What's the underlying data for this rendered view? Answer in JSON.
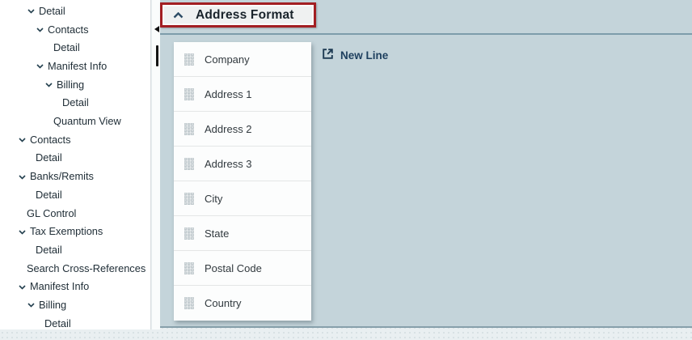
{
  "header": {
    "title": "Address Format",
    "collapse_icon": "chevron-up",
    "highlight_border_color": "#a21e22"
  },
  "toolbar": {
    "new_line_label": "New Line",
    "new_line_icon": "new-line"
  },
  "fields": [
    "Company",
    "Address 1",
    "Address 2",
    "Address 3",
    "City",
    "State",
    "Postal Code",
    "Country"
  ],
  "fields_row_icon": "drag-handle",
  "sidebar": {
    "tree": [
      {
        "label": "Detail",
        "expanded": true,
        "indent": 1,
        "children": [
          {
            "label": "Contacts",
            "expanded": true,
            "children": [
              {
                "label": "Detail"
              }
            ]
          },
          {
            "label": "Manifest Info",
            "expanded": true,
            "children": [
              {
                "label": "Billing",
                "expanded": true,
                "children": [
                  {
                    "label": "Detail"
                  }
                ]
              },
              {
                "label": "Quantum View"
              }
            ]
          }
        ]
      },
      {
        "label": "Contacts",
        "expanded": true,
        "children": [
          {
            "label": "Detail"
          }
        ]
      },
      {
        "label": "Banks/Remits",
        "expanded": true,
        "children": [
          {
            "label": "Detail"
          }
        ]
      },
      {
        "label": "GL Control"
      },
      {
        "label": "Tax Exemptions",
        "expanded": true,
        "children": [
          {
            "label": "Detail"
          }
        ]
      },
      {
        "label": "Search Cross-References"
      },
      {
        "label": "Manifest Info",
        "expanded": true,
        "children": [
          {
            "label": "Billing",
            "expanded": true,
            "children": [
              {
                "label": "Detail"
              }
            ]
          }
        ]
      }
    ]
  },
  "colors": {
    "panel_background": "#c4d4da",
    "panel_separator": "#7e9dab",
    "accent_text": "#1d3f5e",
    "highlight_border": "#a21e22"
  }
}
